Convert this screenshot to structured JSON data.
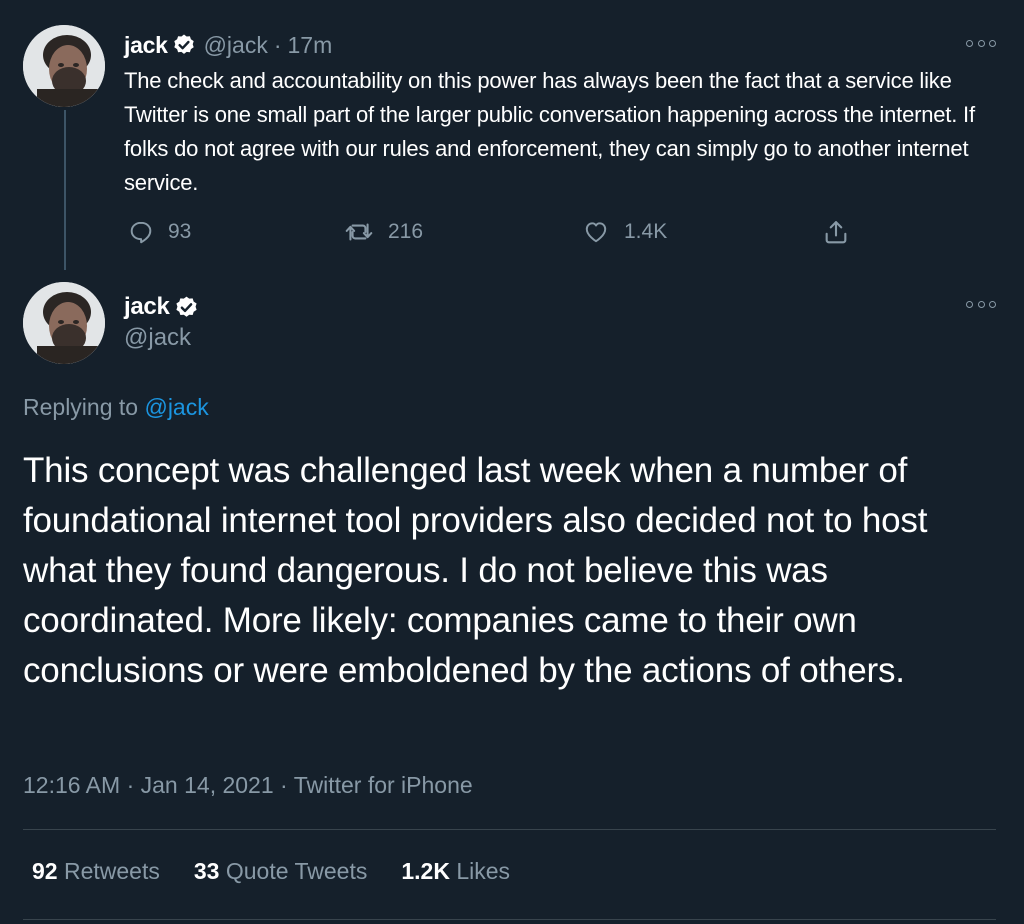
{
  "colors": {
    "background": "#15202b",
    "text_primary": "#ffffff",
    "text_muted": "#8899a6",
    "link": "#1b95e0",
    "divider": "#38444d",
    "thread_line": "#3d5466"
  },
  "icons": {
    "verified": "verified-badge-icon",
    "more": "more-options-icon",
    "reply": "reply-icon",
    "retweet": "retweet-icon",
    "like": "heart-icon",
    "share": "share-icon"
  },
  "parent_tweet": {
    "name": "jack",
    "handle": "@jack",
    "separator": "·",
    "time": "17m",
    "text": "The check and accountability on this power has always been the fact that a service like Twitter is one small part of the larger public conversation happening across the internet. If folks do not agree with our rules and enforcement, they can simply go to another internet service.",
    "actions": {
      "replies": "93",
      "retweets": "216",
      "likes": "1.4K"
    }
  },
  "main_tweet": {
    "name": "jack",
    "handle": "@jack",
    "replying_prefix": "Replying to",
    "replying_to": "@jack",
    "text": "This concept was challenged last week when a number of foundational internet tool providers also decided not to host what they found dangerous. I do not believe this was coordinated. More likely: companies came to their own conclusions or were emboldened by the actions of others.",
    "time": "12:16 AM",
    "separator": "·",
    "date": "Jan 14, 2021",
    "source": "Twitter for iPhone",
    "stats": {
      "retweets_count": "92",
      "retweets_label": "Retweets",
      "quotes_count": "33",
      "quotes_label": "Quote Tweets",
      "likes_count": "1.2K",
      "likes_label": "Likes"
    }
  }
}
